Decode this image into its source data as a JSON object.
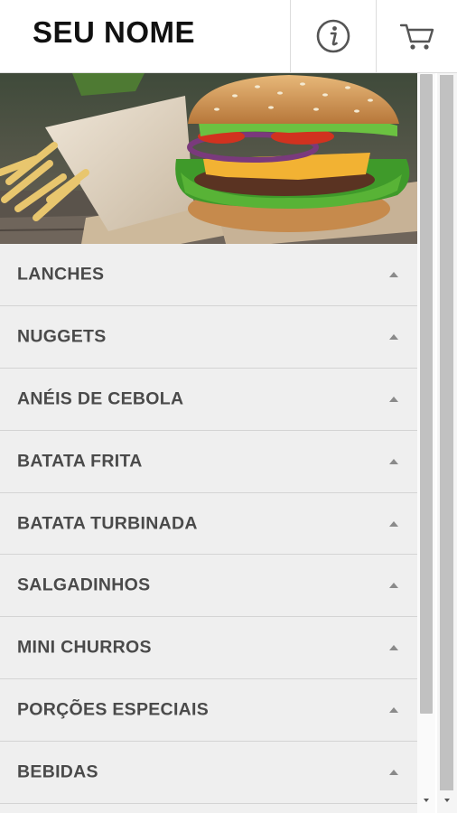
{
  "header": {
    "brand": "SEU NOME",
    "info_icon": "info-circle-icon",
    "cart_icon": "shopping-cart-icon"
  },
  "hero": {
    "image": "burger-and-fries-photo"
  },
  "menu": {
    "items": [
      {
        "label": "LANCHES"
      },
      {
        "label": "NUGGETS"
      },
      {
        "label": "ANÉIS DE CEBOLA"
      },
      {
        "label": "BATATA FRITA"
      },
      {
        "label": "BATATA TURBINADA"
      },
      {
        "label": "SALGADINHOS"
      },
      {
        "label": "MINI CHURROS"
      },
      {
        "label": "PORÇÕES ESPECIAIS"
      },
      {
        "label": "BEBIDAS"
      }
    ]
  },
  "colors": {
    "header_bg": "#ffffff",
    "menu_bg": "#efefef",
    "menu_text": "#4a4a4a",
    "divider": "#d4d4d4",
    "scroll_thumb": "#c1c1c1"
  }
}
